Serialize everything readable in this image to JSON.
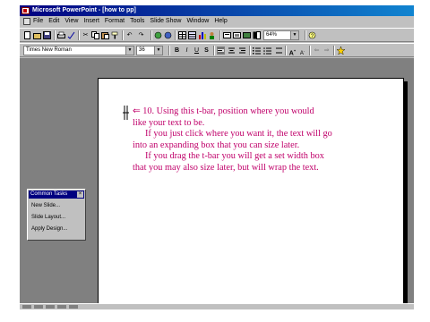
{
  "window": {
    "title": "Microsoft PowerPoint - [how to pp]"
  },
  "menu": {
    "items": [
      "File",
      "Edit",
      "View",
      "Insert",
      "Format",
      "Tools",
      "Slide Show",
      "Window",
      "Help"
    ]
  },
  "toolbar": {
    "zoom": "64%"
  },
  "formatting": {
    "font_name": "Times New Roman",
    "font_size": "36"
  },
  "slide": {
    "paragraphs": [
      {
        "indent": false,
        "lines": [
          "⇐ 10. Using this t-bar, position where you would",
          "like your text to be."
        ]
      },
      {
        "indent": true,
        "lines": [
          "If you just click where you want it, the text will go",
          "into an expanding box that you can size later."
        ]
      },
      {
        "indent": true,
        "lines": [
          "If you drag the t-bar you will get a set width box",
          "that you may also size later, but will wrap the text."
        ]
      }
    ],
    "text_color": "#c0006a"
  },
  "common_tasks": {
    "title": "Common Tasks",
    "items": [
      "New Slide...",
      "Slide Layout...",
      "Apply Design..."
    ]
  }
}
